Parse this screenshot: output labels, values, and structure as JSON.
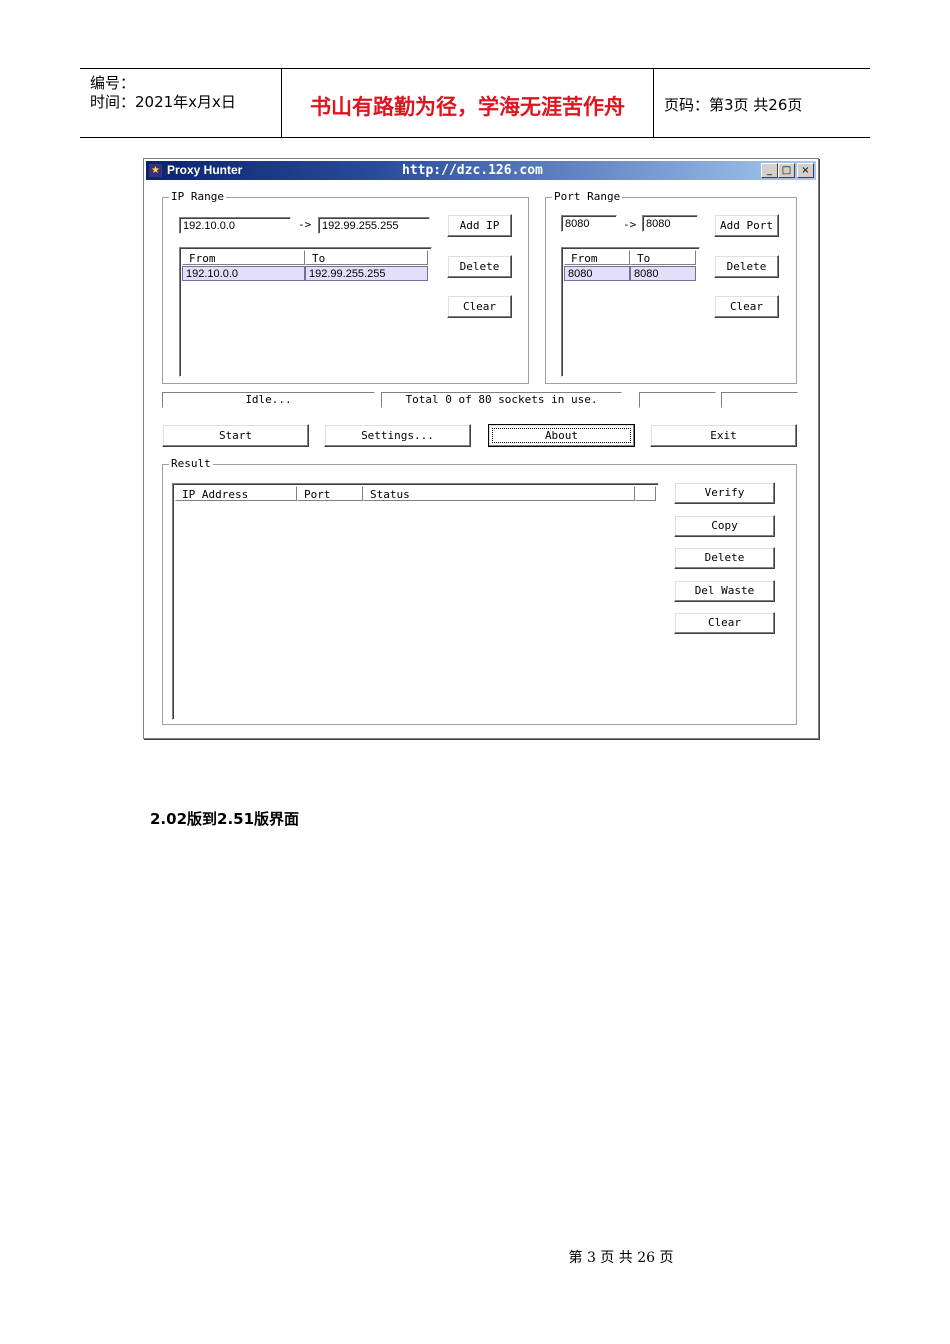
{
  "header": {
    "number_label": "编号：",
    "time_label": "时间：2021年x月x日",
    "motto": "书山有路勤为径，学海无涯苦作舟",
    "page_label": "页码：第3页  共26页",
    "motto_color": "#e0141e"
  },
  "window": {
    "title": "Proxy Hunter",
    "url": "http://dzc.126.com",
    "controls": [
      "_",
      "□",
      "×"
    ],
    "ip_range": {
      "label": "IP Range",
      "from_value": "192.10.0.0",
      "arrow": "->",
      "to_value": "192.99.255.255",
      "list_headers": [
        "From",
        "To"
      ],
      "rows": [
        {
          "from": "192.10.0.0",
          "to": "192.99.255.255"
        }
      ],
      "buttons": [
        "Add IP",
        "Delete",
        "Clear"
      ]
    },
    "port_range": {
      "label": "Port Range",
      "from_value": "8080",
      "arrow": "->",
      "to_value": "8080",
      "list_headers": [
        "From",
        "To"
      ],
      "rows": [
        {
          "from": "8080",
          "to": "8080"
        }
      ],
      "buttons": [
        "Add Port",
        "Delete",
        "Clear"
      ]
    },
    "status": {
      "state": "Idle...",
      "sockets": "Total 0 of 80 sockets in use."
    },
    "actions": [
      "Start",
      "Settings...",
      "About",
      "Exit"
    ],
    "result": {
      "label": "Result",
      "columns": [
        "IP Address",
        "Port",
        "Status"
      ],
      "buttons": [
        "Verify",
        "Copy",
        "Delete",
        "Del Waste",
        "Clear"
      ]
    }
  },
  "caption": "2.02版到2.51版界面",
  "footer": "第 3 页 共 26 页"
}
